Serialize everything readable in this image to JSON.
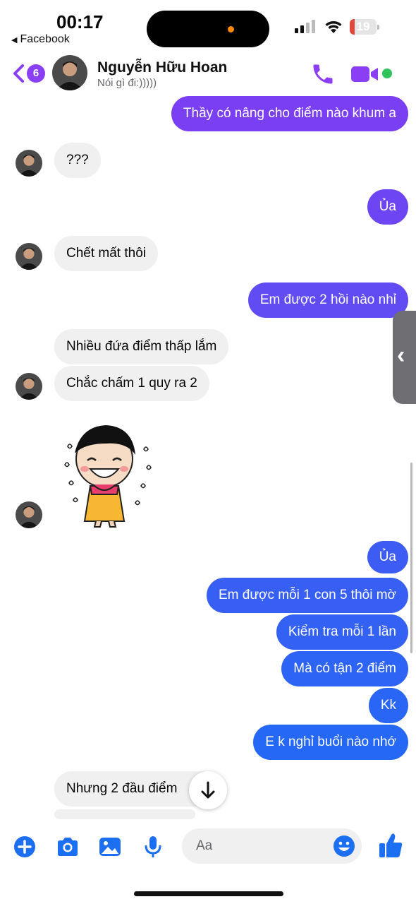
{
  "status_bar": {
    "time": "00:17",
    "back_app": "Facebook",
    "battery": "19",
    "battery_level": 0.19
  },
  "header": {
    "unread_count": "6",
    "contact_name": "Nguyễn Hữu Hoan",
    "contact_status": "Nói gì đi:)))))",
    "online": true
  },
  "colors": {
    "accent": "#8b3ff4",
    "out_bubble_top": "#7b3ff2",
    "out_bubble_bottom": "#1f6bf5",
    "in_bubble": "#f0f0f0",
    "online": "#31c45a"
  },
  "messages": [
    {
      "from": "me",
      "text": "Thầy có nâng cho điểm nào khum a"
    },
    {
      "from": "them",
      "text": "???"
    },
    {
      "from": "me",
      "text": "Ủa"
    },
    {
      "from": "them",
      "text": "Chết mất thôi"
    },
    {
      "from": "me",
      "text": "Em được 2 hồi nào nhỉ"
    },
    {
      "from": "them",
      "text": "Nhiều đứa điểm thấp lắm"
    },
    {
      "from": "them",
      "text": "Chắc chấm 1 quy ra 2"
    },
    {
      "from": "them",
      "sticker": "crying-girl-sticker"
    },
    {
      "from": "me",
      "text": "Ủa"
    },
    {
      "from": "me",
      "text": "Em được mỗi 1 con 5 thôi mờ"
    },
    {
      "from": "me",
      "text": "Kiểm tra mỗi 1 lần"
    },
    {
      "from": "me",
      "text": "Mà có tận 2 điểm"
    },
    {
      "from": "me",
      "text": "Kk"
    },
    {
      "from": "me",
      "text": "E k nghỉ buổi nào nhớ"
    },
    {
      "from": "them",
      "text": "Nhưng 2 đầu điểm"
    }
  ],
  "composer": {
    "placeholder": "Aa",
    "icons": [
      "plus-icon",
      "camera-icon",
      "image-icon",
      "microphone-icon",
      "emoji-icon",
      "like-icon"
    ]
  }
}
